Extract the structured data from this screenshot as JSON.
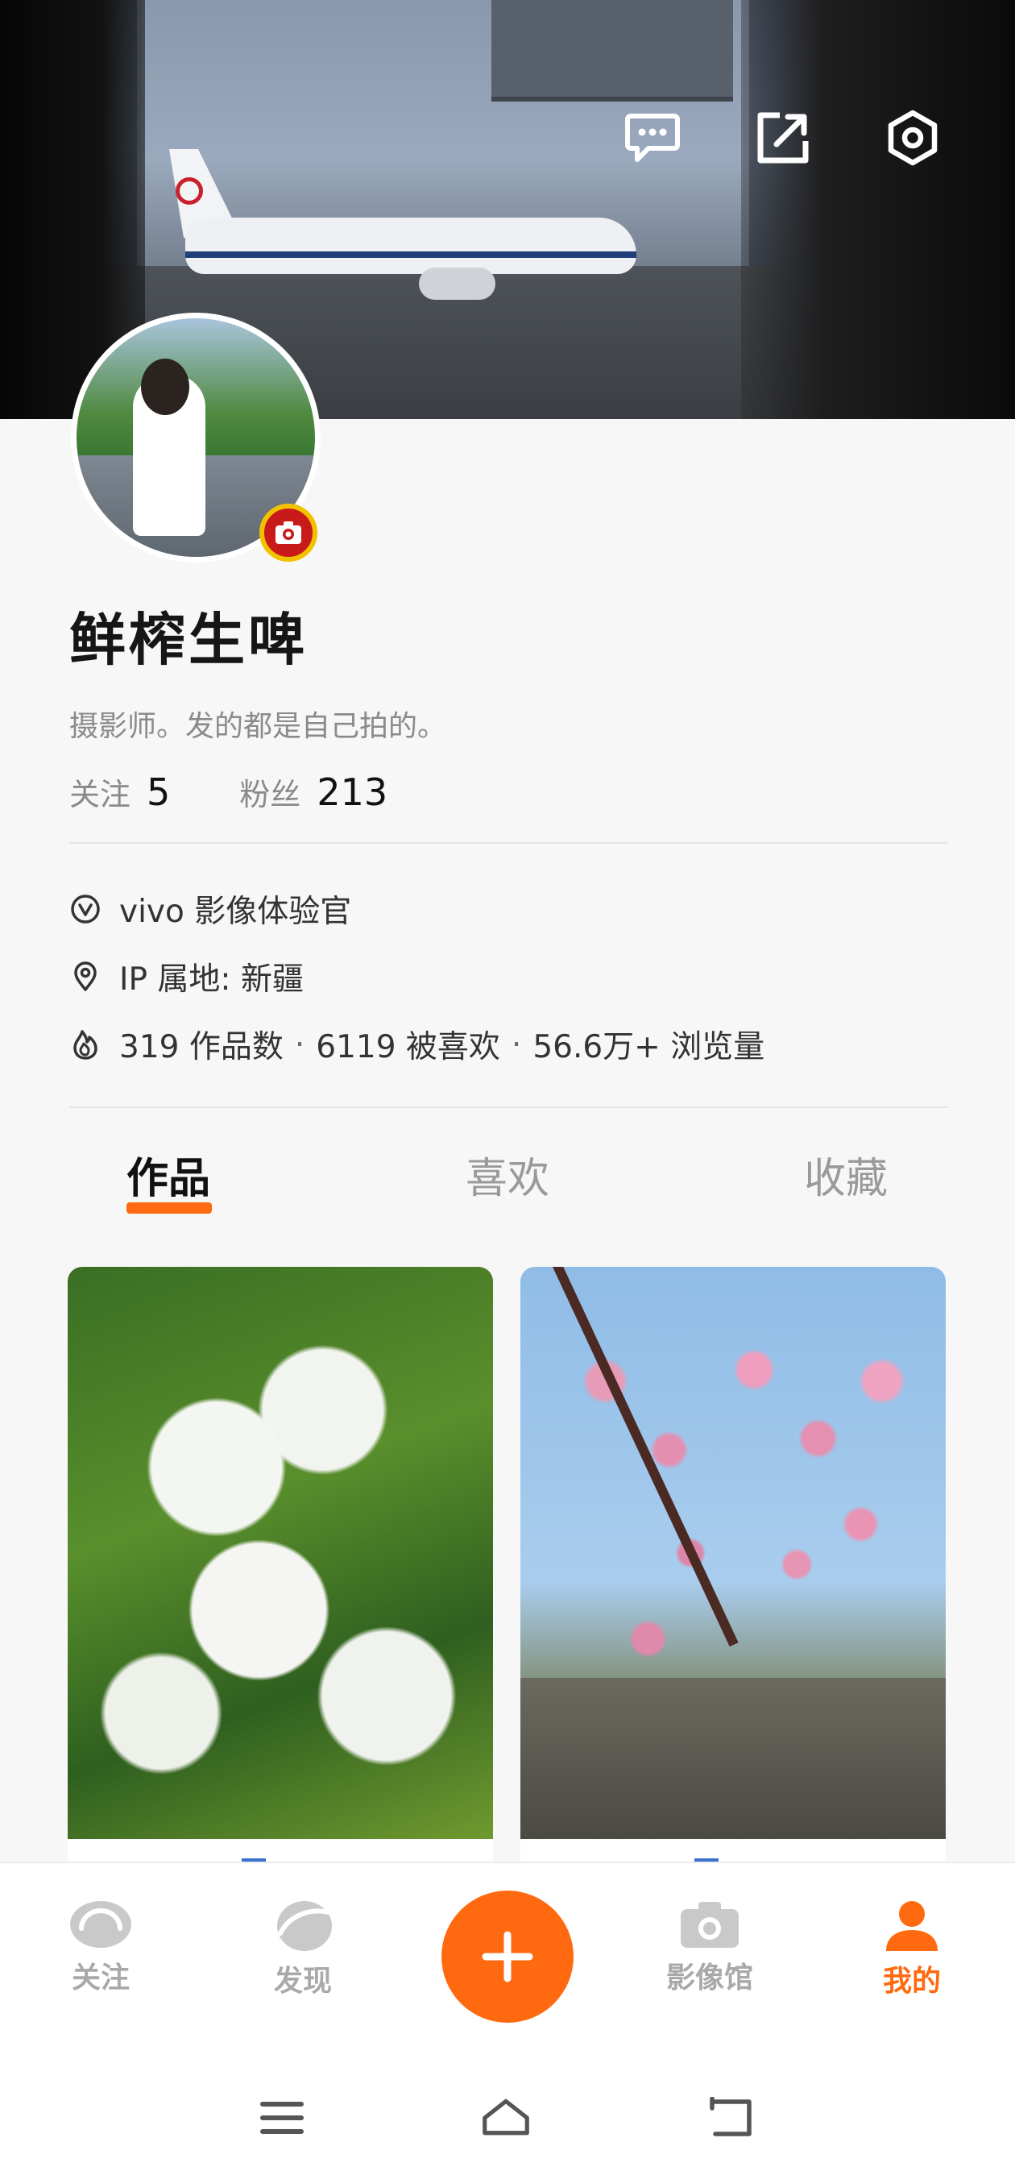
{
  "header": {
    "icons": [
      "message-icon",
      "share-icon",
      "settings-icon"
    ]
  },
  "profile": {
    "name": "鲜榨生啤",
    "bio": "摄影师。发的都是自己拍的。",
    "following_label": "关注",
    "following_count": "5",
    "followers_label": "粉丝",
    "followers_count": "213"
  },
  "info": {
    "badge": "vivo 影像体验官",
    "ip_location": "IP 属地: 新疆",
    "works": "319 作品数",
    "likes": "6119 被喜欢",
    "views": "56.6万+ 浏览量",
    "separator": "·"
  },
  "tabs": [
    {
      "label": "作品",
      "active": true
    },
    {
      "label": "喜欢",
      "active": false
    },
    {
      "label": "收藏",
      "active": false
    }
  ],
  "bottom_nav": [
    {
      "label": "关注",
      "icon": "follow-icon",
      "active": false
    },
    {
      "label": "发现",
      "icon": "discover-icon",
      "active": false
    },
    {
      "label": "",
      "icon": "plus-icon",
      "active": false
    },
    {
      "label": "影像馆",
      "icon": "camera-icon",
      "active": false
    },
    {
      "label": "我的",
      "icon": "person-icon",
      "active": true
    }
  ],
  "colors": {
    "accent": "#ff6a10",
    "badge_red": "#c81a1a",
    "badge_yellow": "#f2c200"
  }
}
